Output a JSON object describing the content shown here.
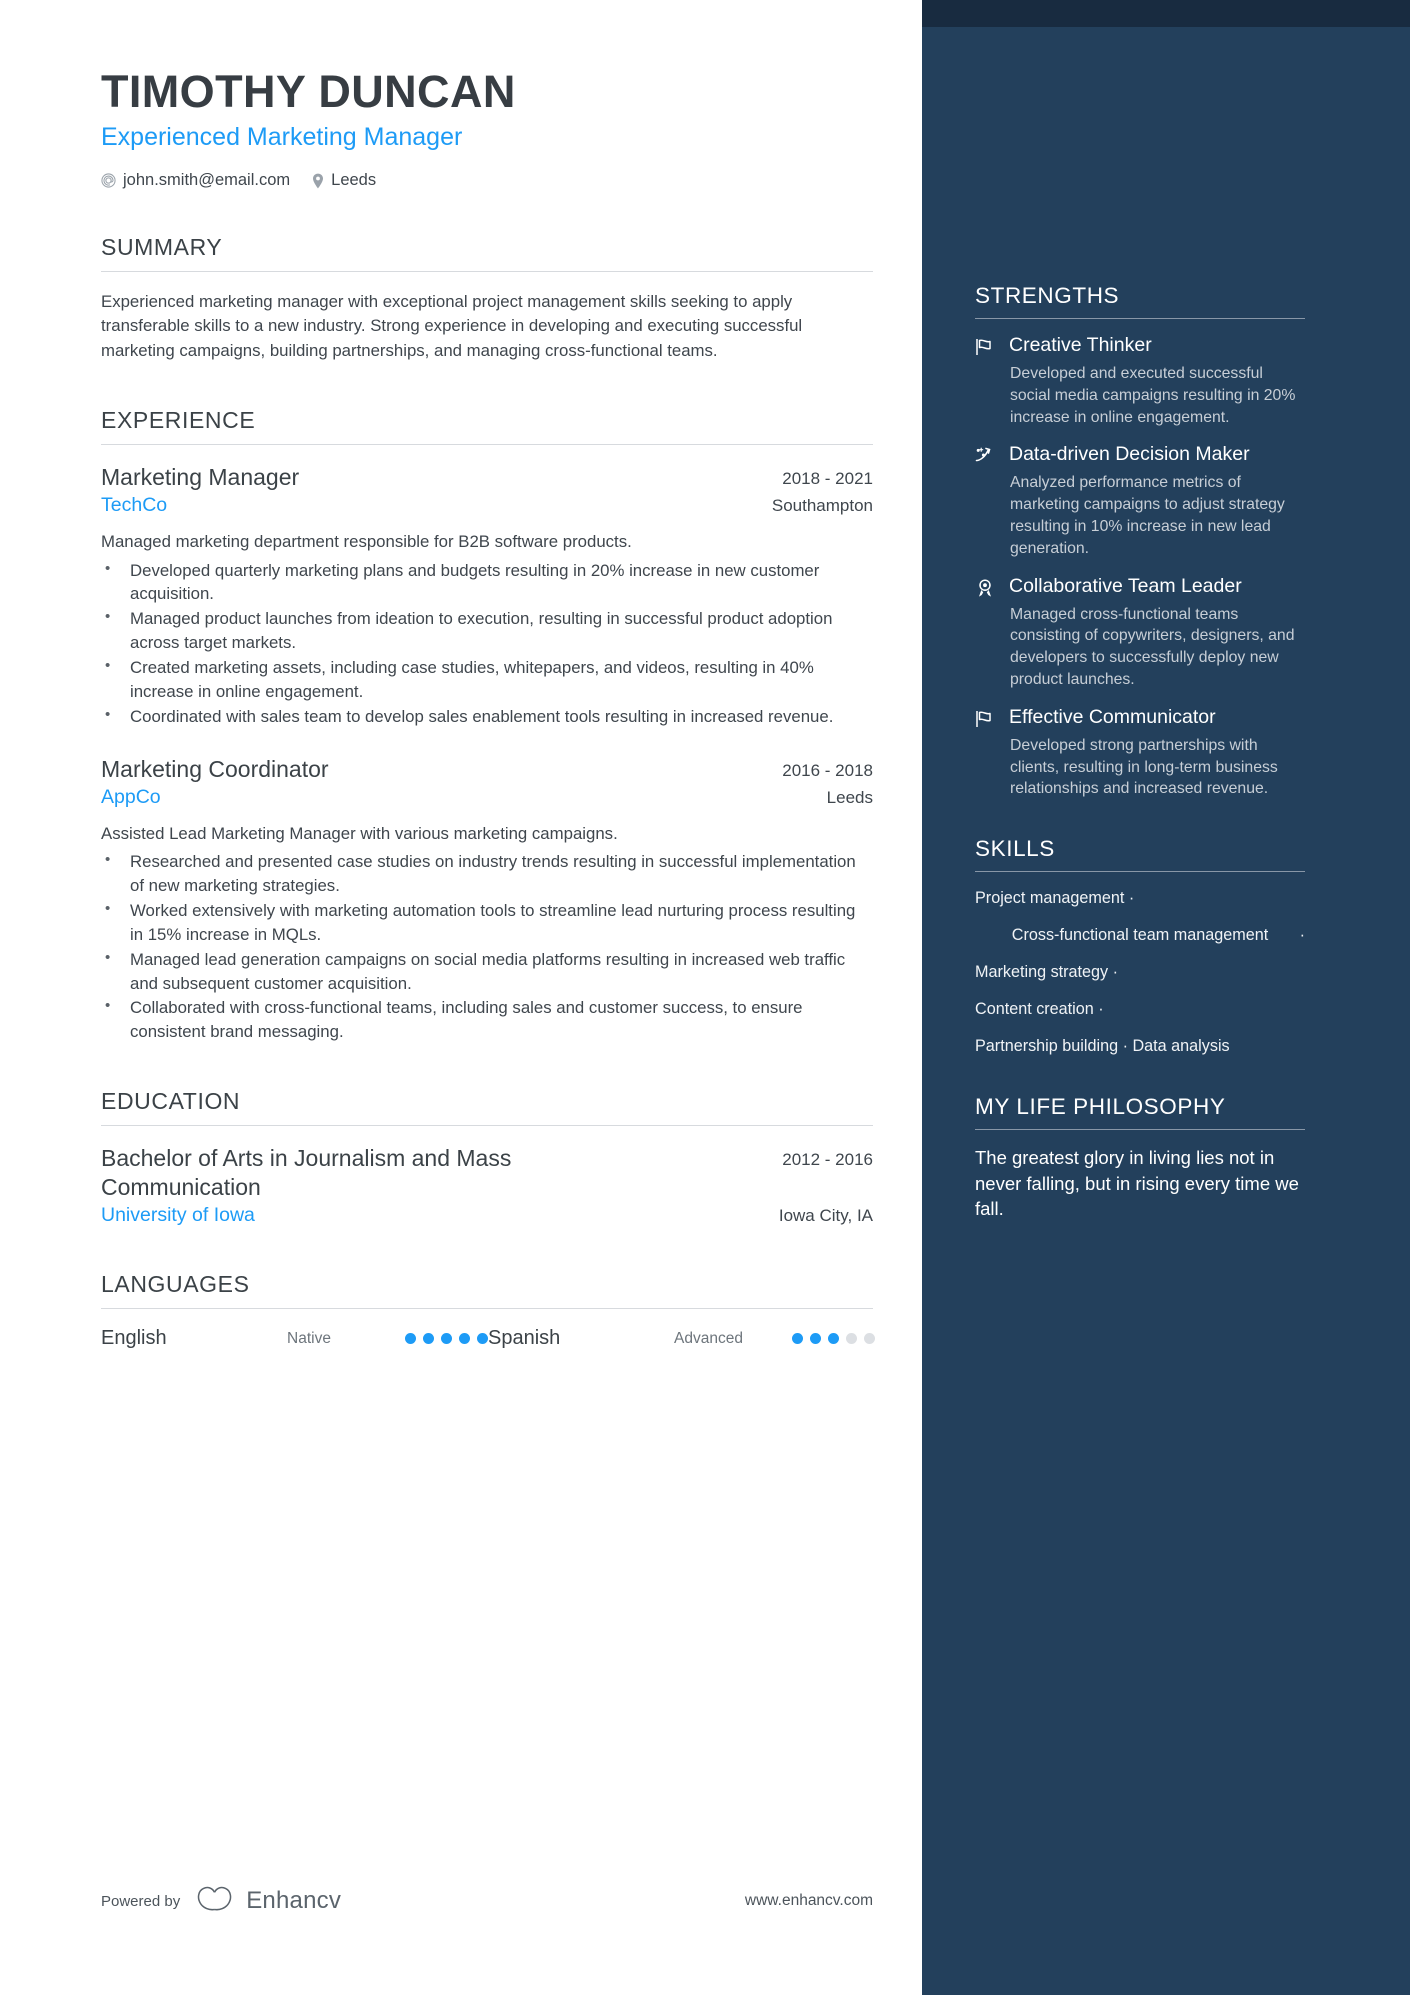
{
  "colors": {
    "accent": "#1d9bf6",
    "sidebar_bg": "#23405c",
    "sidebar_top_strip": "#182b40",
    "heading": "#3b4247",
    "body_text": "#3f464d"
  },
  "header": {
    "name": "TIMOTHY DUNCAN",
    "job_title": "Experienced Marketing Manager",
    "contacts": [
      {
        "icon": "email-icon",
        "value": "john.smith@email.com"
      },
      {
        "icon": "location-pin-icon",
        "value": "Leeds"
      }
    ]
  },
  "summary": {
    "title": "SUMMARY",
    "text": "Experienced marketing manager with exceptional project management skills seeking to apply transferable skills to a new industry. Strong experience in developing and executing successful marketing campaigns, building partnerships, and managing cross-functional teams."
  },
  "experience": {
    "title": "EXPERIENCE",
    "entries": [
      {
        "role": "Marketing Manager",
        "date": "2018 - 2021",
        "company": "TechCo",
        "location": "Southampton",
        "description": "Managed marketing department responsible for B2B software products.",
        "bullets": [
          "Developed quarterly marketing plans and budgets resulting in 20% increase in new customer acquisition.",
          "Managed product launches from ideation to execution, resulting in successful product adoption across target markets.",
          "Created marketing assets, including case studies, whitepapers, and videos, resulting in 40% increase in online engagement.",
          "Coordinated with sales team to develop sales enablement tools resulting in increased revenue."
        ]
      },
      {
        "role": "Marketing Coordinator",
        "date": "2016 - 2018",
        "company": "AppCo",
        "location": "Leeds",
        "description": "Assisted Lead Marketing Manager with various marketing campaigns.",
        "bullets": [
          "Researched and presented case studies on industry trends resulting in successful implementation of new marketing strategies.",
          "Worked extensively with marketing automation tools to streamline lead nurturing process resulting in 15% increase in MQLs.",
          "Managed lead generation campaigns on social media platforms resulting in increased web traffic and subsequent customer acquisition.",
          "Collaborated with cross-functional teams, including sales and customer success, to ensure consistent brand messaging."
        ]
      }
    ]
  },
  "education": {
    "title": "EDUCATION",
    "entries": [
      {
        "degree": "Bachelor of Arts in Journalism and Mass Communication",
        "date": "2012 - 2016",
        "school": "University of Iowa",
        "location": "Iowa City, IA"
      }
    ]
  },
  "languages": {
    "title": "LANGUAGES",
    "items": [
      {
        "name": "English",
        "level": "Native",
        "rating": 5,
        "max": 5
      },
      {
        "name": "Spanish",
        "level": "Advanced",
        "rating": 3,
        "max": 5
      }
    ]
  },
  "strengths": {
    "title": "STRENGTHS",
    "items": [
      {
        "icon": "flag-icon",
        "name": "Creative Thinker",
        "description": "Developed and executed successful social media campaigns resulting in 20% increase in online engagement."
      },
      {
        "icon": "trend-chart-icon",
        "name": "Data-driven Decision Maker",
        "description": "Analyzed performance metrics of marketing campaigns to adjust strategy resulting in 10% increase in new lead generation."
      },
      {
        "icon": "award-ribbon-icon",
        "name": "Collaborative Team Leader",
        "description": "Managed cross-functional teams consisting of copywriters, designers, and developers to successfully deploy new product launches."
      },
      {
        "icon": "flag-icon",
        "name": "Effective Communicator",
        "description": "Developed strong partnerships with clients, resulting in long-term business relationships and increased revenue."
      }
    ]
  },
  "skills": {
    "title": "SKILLS",
    "lines": [
      {
        "text": "Project management ·",
        "centered": false
      },
      {
        "text": "Cross-functional team management",
        "centered": true,
        "trailing_separator": "·"
      },
      {
        "text": "Marketing strategy ·",
        "centered": false
      },
      {
        "text": "Content creation ·",
        "centered": false
      },
      {
        "text": "Partnership building · Data analysis",
        "centered": false
      }
    ]
  },
  "philosophy": {
    "title": "MY LIFE PHILOSOPHY",
    "text": "The greatest glory in living lies not in never falling, but in rising every time we fall."
  },
  "footer": {
    "powered_label": "Powered by",
    "brand_name": "Enhancv",
    "url": "www.enhancv.com"
  }
}
